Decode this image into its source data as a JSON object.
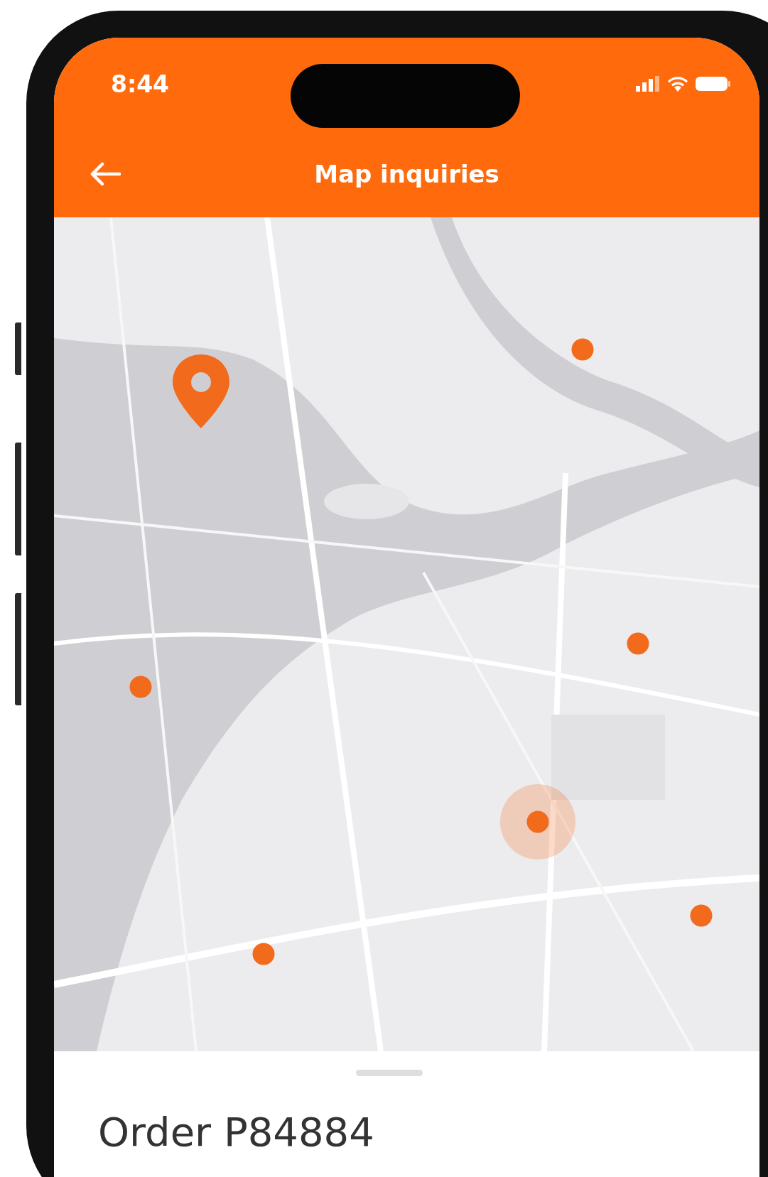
{
  "status_bar": {
    "time": "8:44"
  },
  "header": {
    "title": "Map inquiries"
  },
  "map": {
    "kind": "picture",
    "markers": [
      {
        "kind": "pin",
        "selected": false
      },
      {
        "kind": "dot",
        "selected": false
      },
      {
        "kind": "dot",
        "selected": false
      },
      {
        "kind": "dot",
        "selected": false
      },
      {
        "kind": "dot",
        "selected": true
      },
      {
        "kind": "dot",
        "selected": false
      },
      {
        "kind": "dot",
        "selected": false
      }
    ]
  },
  "sheet": {
    "title": "Order P84884"
  }
}
